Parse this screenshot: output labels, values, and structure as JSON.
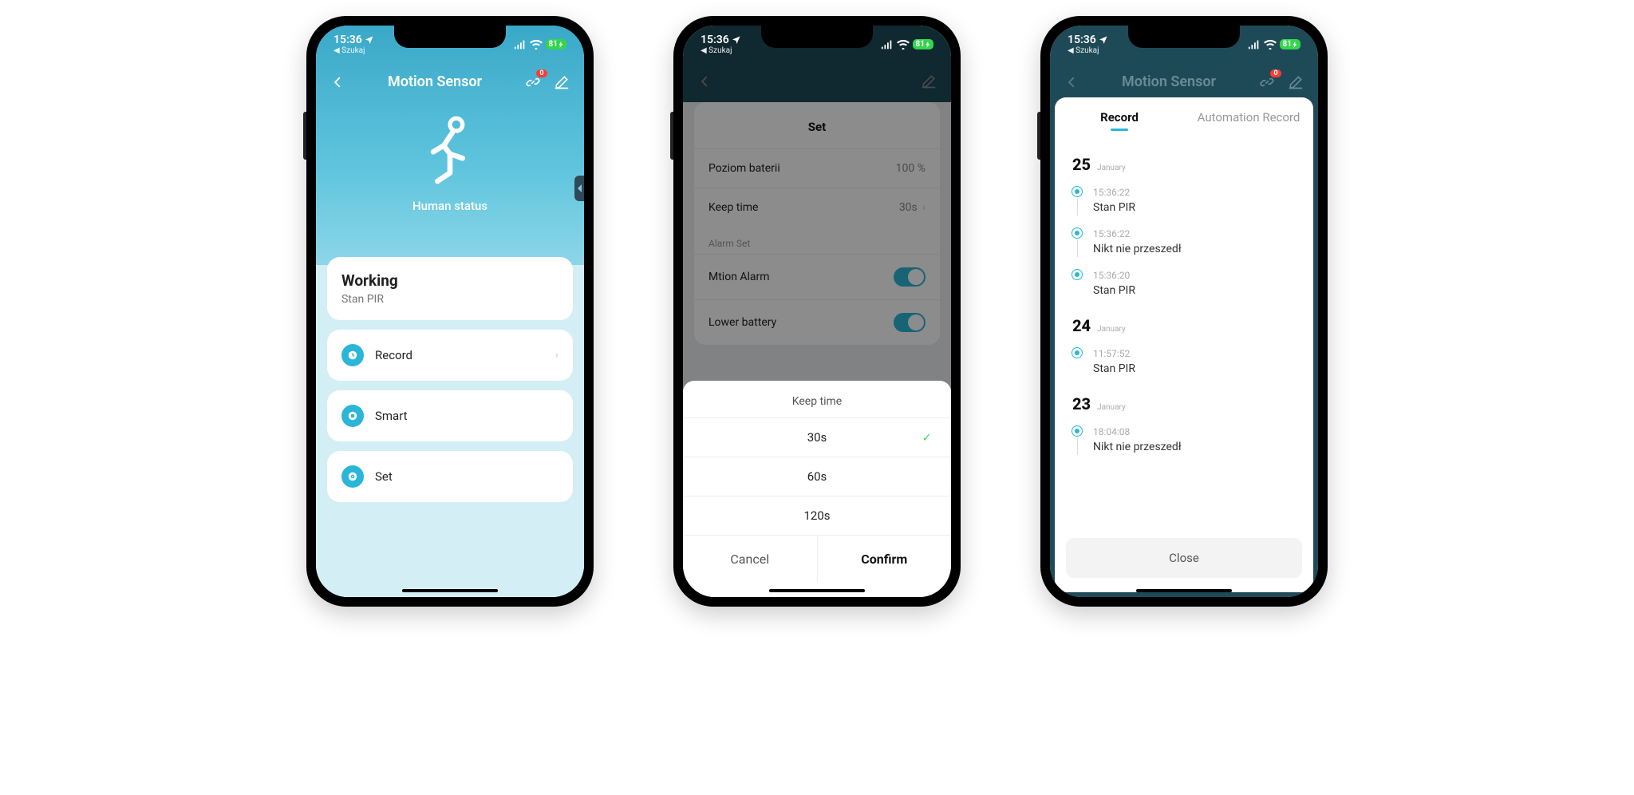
{
  "status": {
    "time": "15:36",
    "back_app": "◀ Szukaj",
    "battery": "81"
  },
  "phone1": {
    "title": "Motion Sensor",
    "notif_count": "0",
    "hero_label": "Human status",
    "status_card": {
      "title": "Working",
      "sub": "Stan PIR"
    },
    "rows": {
      "record": "Record",
      "smart": "Smart",
      "set": "Set"
    }
  },
  "phone2": {
    "set_title": "Set",
    "battery_label": "Poziom baterii",
    "battery_value": "100 %",
    "keep_time_label": "Keep time",
    "keep_time_value": "30s",
    "section_alarm": "Alarm Set",
    "motion_alarm": "Mtion Alarm",
    "lower_battery": "Lower battery",
    "sheet": {
      "title": "Keep time",
      "opt1": "30s",
      "opt2": "60s",
      "opt3": "120s",
      "cancel": "Cancel",
      "confirm": "Confirm"
    }
  },
  "phone3": {
    "title": "Motion Sensor",
    "notif_count": "0",
    "tab_record": "Record",
    "tab_auto": "Automation Record",
    "month": "January",
    "d25": "25",
    "d24": "24",
    "d23": "23",
    "entries": {
      "e1_time": "15:36:22",
      "e1_text": "Stan PIR",
      "e2_time": "15:36:22",
      "e2_text": "Nikt nie przeszedł",
      "e3_time": "15:36:20",
      "e3_text": "Stan PIR",
      "e4_time": "11:57:52",
      "e4_text": "Stan PIR",
      "e5_time": "18:04:08",
      "e5_text": "Nikt nie przeszedł"
    },
    "close": "Close"
  }
}
